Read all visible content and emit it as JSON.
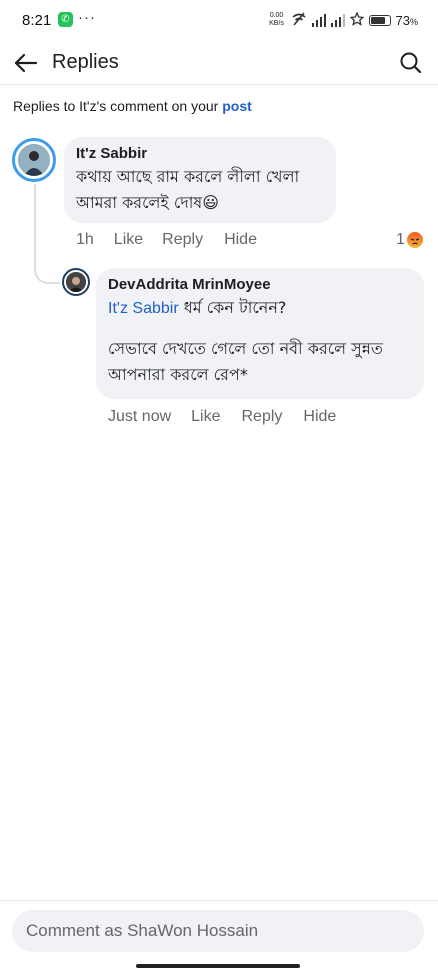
{
  "status_bar": {
    "time": "8:21",
    "dots": "···",
    "net_speed": "0.00\nKB/s",
    "battery": "73",
    "battery_unit": "%"
  },
  "header": {
    "title": "Replies"
  },
  "context": {
    "prefix": "Replies to It'z's comment on your ",
    "link": "post"
  },
  "comments": [
    {
      "author": "It'z Sabbir",
      "lines": [
        "কথায় আছে রাম করলে লীলা খেলা",
        "আমরা করলেই দোষ😃"
      ],
      "time": "1h",
      "like": "Like",
      "reply": "Reply",
      "hide": "Hide",
      "reaction_count": "1"
    },
    {
      "author": "DevAddrita MrinMoyee",
      "mention": "It'z Sabbir",
      "line1_rest": " ধর্ম কেন টানেন?",
      "line2": "সেভাবে দেখতে গেলে তো নবী করলে সুন্নত",
      "line3": "আপনারা করলে রেপ*",
      "time": "Just now",
      "like": "Like",
      "reply": "Reply",
      "hide": "Hide"
    }
  ],
  "footer": {
    "placeholder": "Comment as ShaWon Hossain"
  },
  "colors": {
    "link_blue": "#1f61c8",
    "bubble_bg": "#f0f2f5",
    "avatar_ring": "#3b9cf0"
  }
}
